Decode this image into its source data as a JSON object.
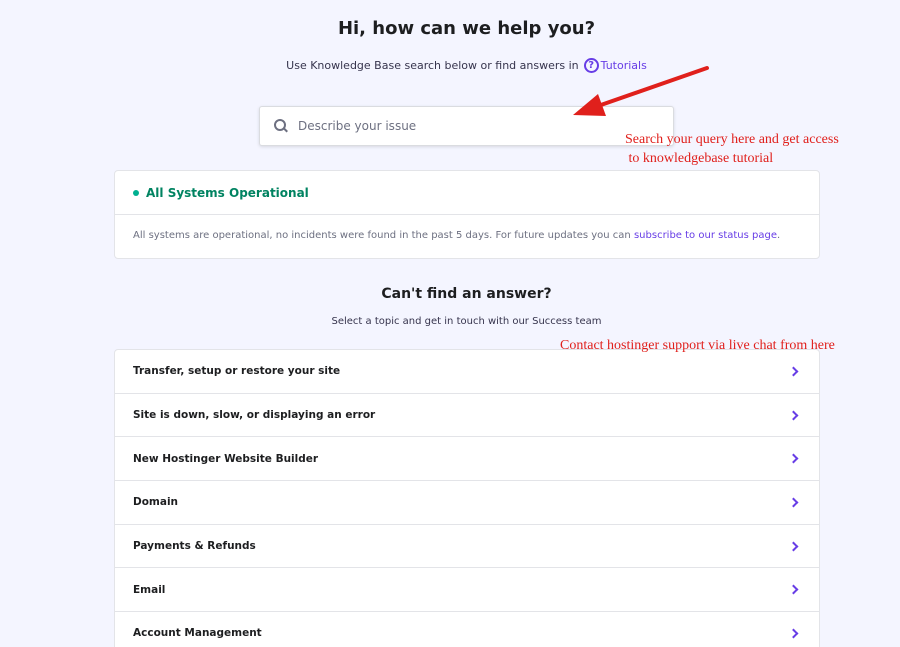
{
  "hero": {
    "title": "Hi, how can we help you?",
    "subtitle": "Use Knowledge Base search below or find answers in",
    "tutorials_label": "Tutorials"
  },
  "search": {
    "placeholder": "Describe your issue"
  },
  "status": {
    "title": "All Systems Operational",
    "message": "All systems are operational, no incidents were found in the past 5 days. For future updates you can",
    "link_text": "subscribe to our status page",
    "link_suffix": "."
  },
  "topics_section": {
    "title": "Can't find an answer?",
    "subtitle": "Select a topic and get in touch with our Success team",
    "items": [
      {
        "label": "Transfer, setup or restore your site"
      },
      {
        "label": "Site is down, slow, or displaying an error"
      },
      {
        "label": "New Hostinger Website Builder"
      },
      {
        "label": "Domain"
      },
      {
        "label": "Payments & Refunds"
      },
      {
        "label": "Email"
      },
      {
        "label": "Account Management"
      }
    ]
  },
  "annotations": {
    "search_note_line1": "Search your query here and get access",
    "search_note_line2": " to knowledgebase tutorial",
    "contact_note": "Contact hostinger support via live chat from here"
  },
  "colors": {
    "accent": "#673de6",
    "status_green": "#008361",
    "annotation_red": "#e0201c",
    "background": "#f4f5ff"
  }
}
